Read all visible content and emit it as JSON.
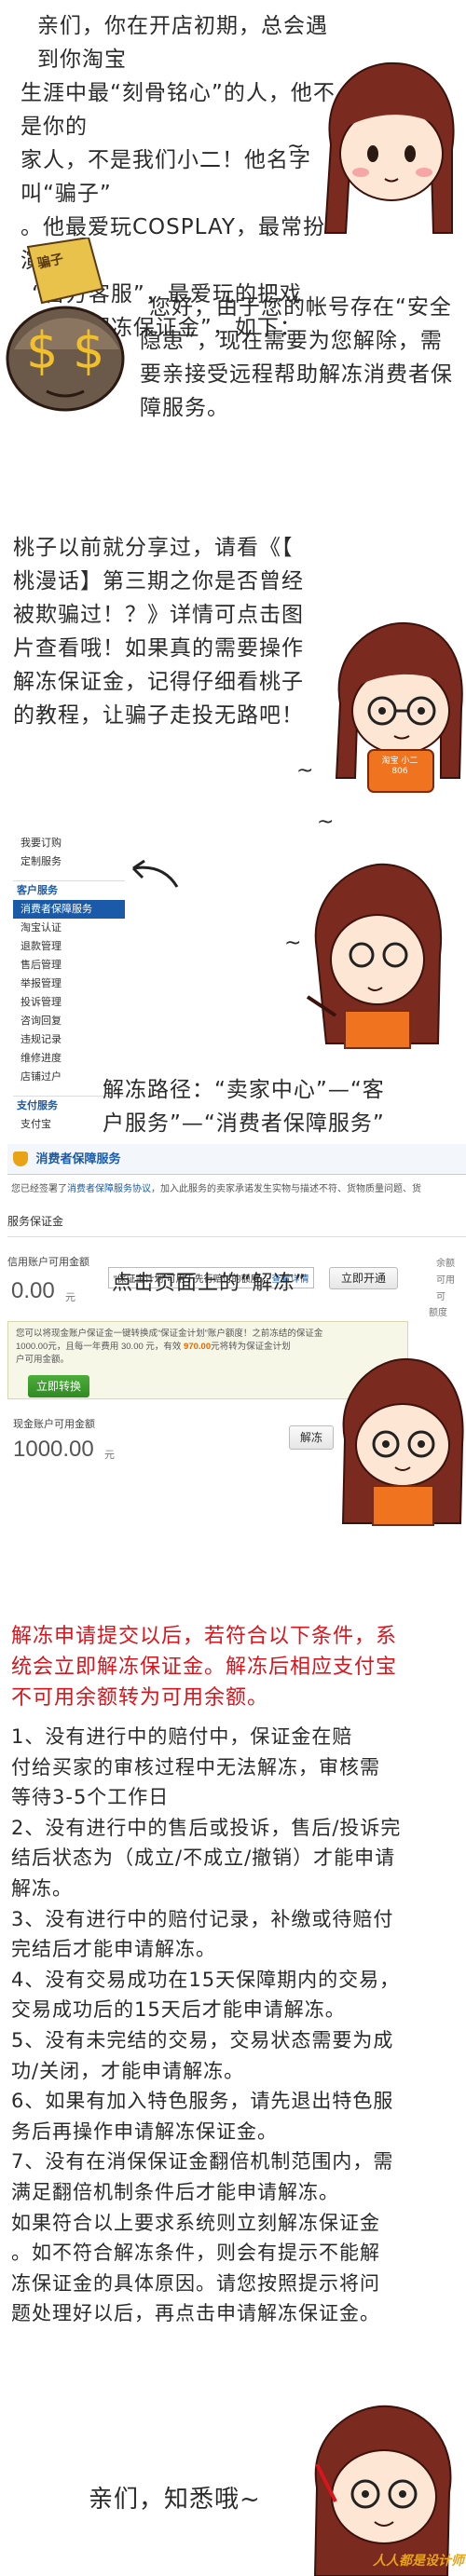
{
  "intro": {
    "lines": [
      "亲们，你在开店初期，总会遇到你淘宝",
      "生涯中最“刻骨铭心”的人，他不是你的",
      "家人，不是我们小二！他名字叫“骗子”",
      "。他最爱玩COSPLAY，最常扮演",
      "“官方客服”，最爱玩的把戏",
      "就是“解冻保证金”，如下："
    ]
  },
  "scammer": {
    "bag_label": "骗子",
    "lines": [
      "您好，由于您的帐号存在“安全",
      "隐患”，现在需要为您解除，需",
      "要亲接受远程帮助解冻消费者保",
      "障服务。"
    ]
  },
  "tip": {
    "lines": [
      "桃子以前就分享过，请看《【",
      "桃漫话】第三期之你是否曾经",
      "被欺骗过！？》详情可点击图",
      "片查看哦！如果真的需要操作",
      "解冻保证金，记得仔细看桃子",
      "的教程，让骗子走投无路吧！"
    ],
    "shirt_text": "淘宝 小二 806"
  },
  "sidebar_menu": {
    "top_items": [
      "我要订购",
      "定制服务"
    ],
    "section_label": "客户服务",
    "items": [
      "消费者保障服务",
      "淘宝认证",
      "退款管理",
      "售后管理",
      "举报管理",
      "投诉管理",
      "咨询回复",
      "违规记录",
      "维修进度",
      "店铺过户"
    ],
    "section2_label": "支付服务",
    "section2_items": [
      "支付宝"
    ]
  },
  "path_text": {
    "lines": [
      "解冻路径：“卖家中心”—“客",
      "户服务”—“消费者保障服务”"
    ]
  },
  "service_panel": {
    "header_title": "消费者保障服务",
    "notice_prefix": "您已经签署了",
    "notice_link": "消费者保障服务协议",
    "notice_suffix": "，加入此服务的卖家承诺发生实物与描述不符、货物质量问题、货",
    "section_title": "服务保证金",
    "credit_label": "信用账户可用金额",
    "credit_value": "0.00",
    "credit_unit": "元",
    "tooltip_text": "“保证金计划”可用于先行赔付的额度。",
    "tooltip_link": "查看详情",
    "open_button": "立即开通",
    "right_col": [
      "余额",
      "可用",
      "可"
    ],
    "prompt_text": "点击页面上的“解冻”",
    "right_label": "额度",
    "promo_line1": "您可以将现金账户保证金一键转换成“保证金计划”账户额度！之前冻结的保证金",
    "promo_line2a": "1000.00元",
    "promo_line2b": "，且每一年费用 30.00 元，有效 ",
    "promo_line2c": "970.00",
    "promo_line2d": "元将转为保证金计划",
    "promo_line3": "户可用金额。",
    "convert_button": "立即转换",
    "cash_label": "现金账户可用金额",
    "cash_value": "1000.00",
    "cash_unit": "元",
    "unfreeze_button": "解冻"
  },
  "conditions": {
    "headline": [
      "解冻申请提交以后，若符合以下条件，系",
      "统会立即解冻保证金。解冻后相应支付宝",
      "不可用余额转为可用余额。"
    ],
    "lines": [
      "1、没有进行中的赔付中，保证金在赔",
      "付给买家的审核过程中无法解冻，审核需",
      "等待3-5个工作日",
      "2、没有进行中的售后或投诉，售后/投诉完",
      "结后状态为（成立/不成立/撤销）才能申请",
      "解冻。",
      "3、没有进行中的赔付记录，补缴或待赔付",
      "完结后才能申请解冻。",
      "4、没有交易成功在15天保障期内的交易，",
      "交易成功后的15天后才能申请解冻。",
      "5、没有未完结的交易，交易状态需要为成",
      "功/关闭，才能申请解冻。",
      "6、如果有加入特色服务，请先退出特色服",
      "务后再操作申请解冻保证金。",
      "7、没有在消保保证金翻倍机制范围内，需",
      "满足翻倍机制条件后才能申请解冻。",
      "如果符合以上要求系统则立刻解冻保证金",
      "。如不符合解冻条件，则会有提示不能解",
      "冻保证金的具体原因。请您按照提示将问",
      "题处理好以后，再点击申请解冻保证金。"
    ]
  },
  "closing": {
    "text": "亲们，知悉哦~",
    "watermark": "人人都是设计师"
  },
  "colors": {
    "text": "#2b2b2b",
    "accent_red": "#d8141c",
    "hair": "#7a2a1e",
    "skin": "#fde7d4",
    "shirt": "#f07420",
    "panel_link": "#1a5aa8",
    "amount_orange": "#e36a00",
    "green_button": "#3b9a2c"
  }
}
